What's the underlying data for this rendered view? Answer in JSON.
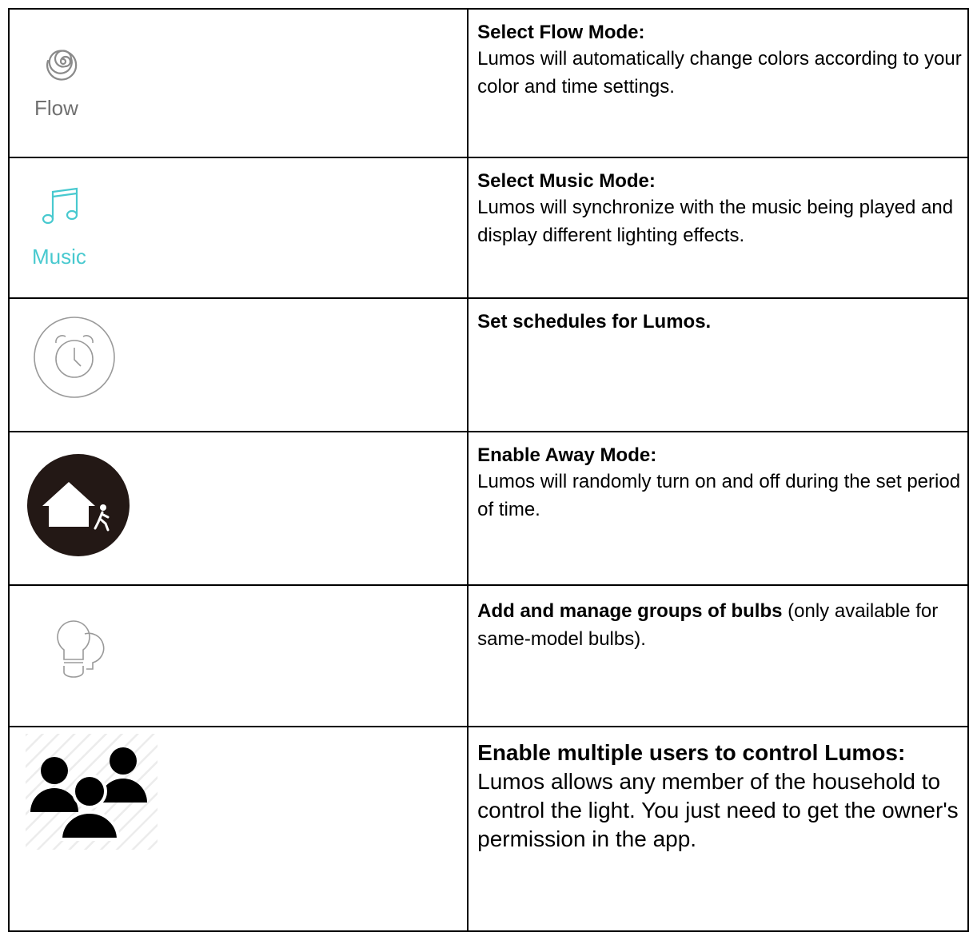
{
  "rows": [
    {
      "icon": "flow-spiral-icon",
      "icon_label": "Flow",
      "icon_color": "#8a8a8a",
      "title": "Select Flow Mode:",
      "description": "Lumos will automatically change colors according to your color and time settings."
    },
    {
      "icon": "music-note-icon",
      "icon_label": "Music",
      "icon_color": "#48c9cf",
      "title": "Select Music Mode:",
      "description": "Lumos will synchronize with the music being played and display different lighting effects."
    },
    {
      "icon": "alarm-clock-icon",
      "title": "Set schedules for Lumos."
    },
    {
      "icon": "away-house-icon",
      "title": "Enable Away Mode:",
      "description": "Lumos will randomly turn on and off during the set period of time."
    },
    {
      "icon": "bulb-group-icon",
      "title": "Add and manage groups of bulbs",
      "description": " (only available for same-model bulbs)."
    },
    {
      "icon": "multiple-users-icon",
      "title": "Enable multiple users to control Lumos:",
      "description": "Lumos allows any member of the household to control the light. You just need to get the owner's permission in the app."
    }
  ]
}
